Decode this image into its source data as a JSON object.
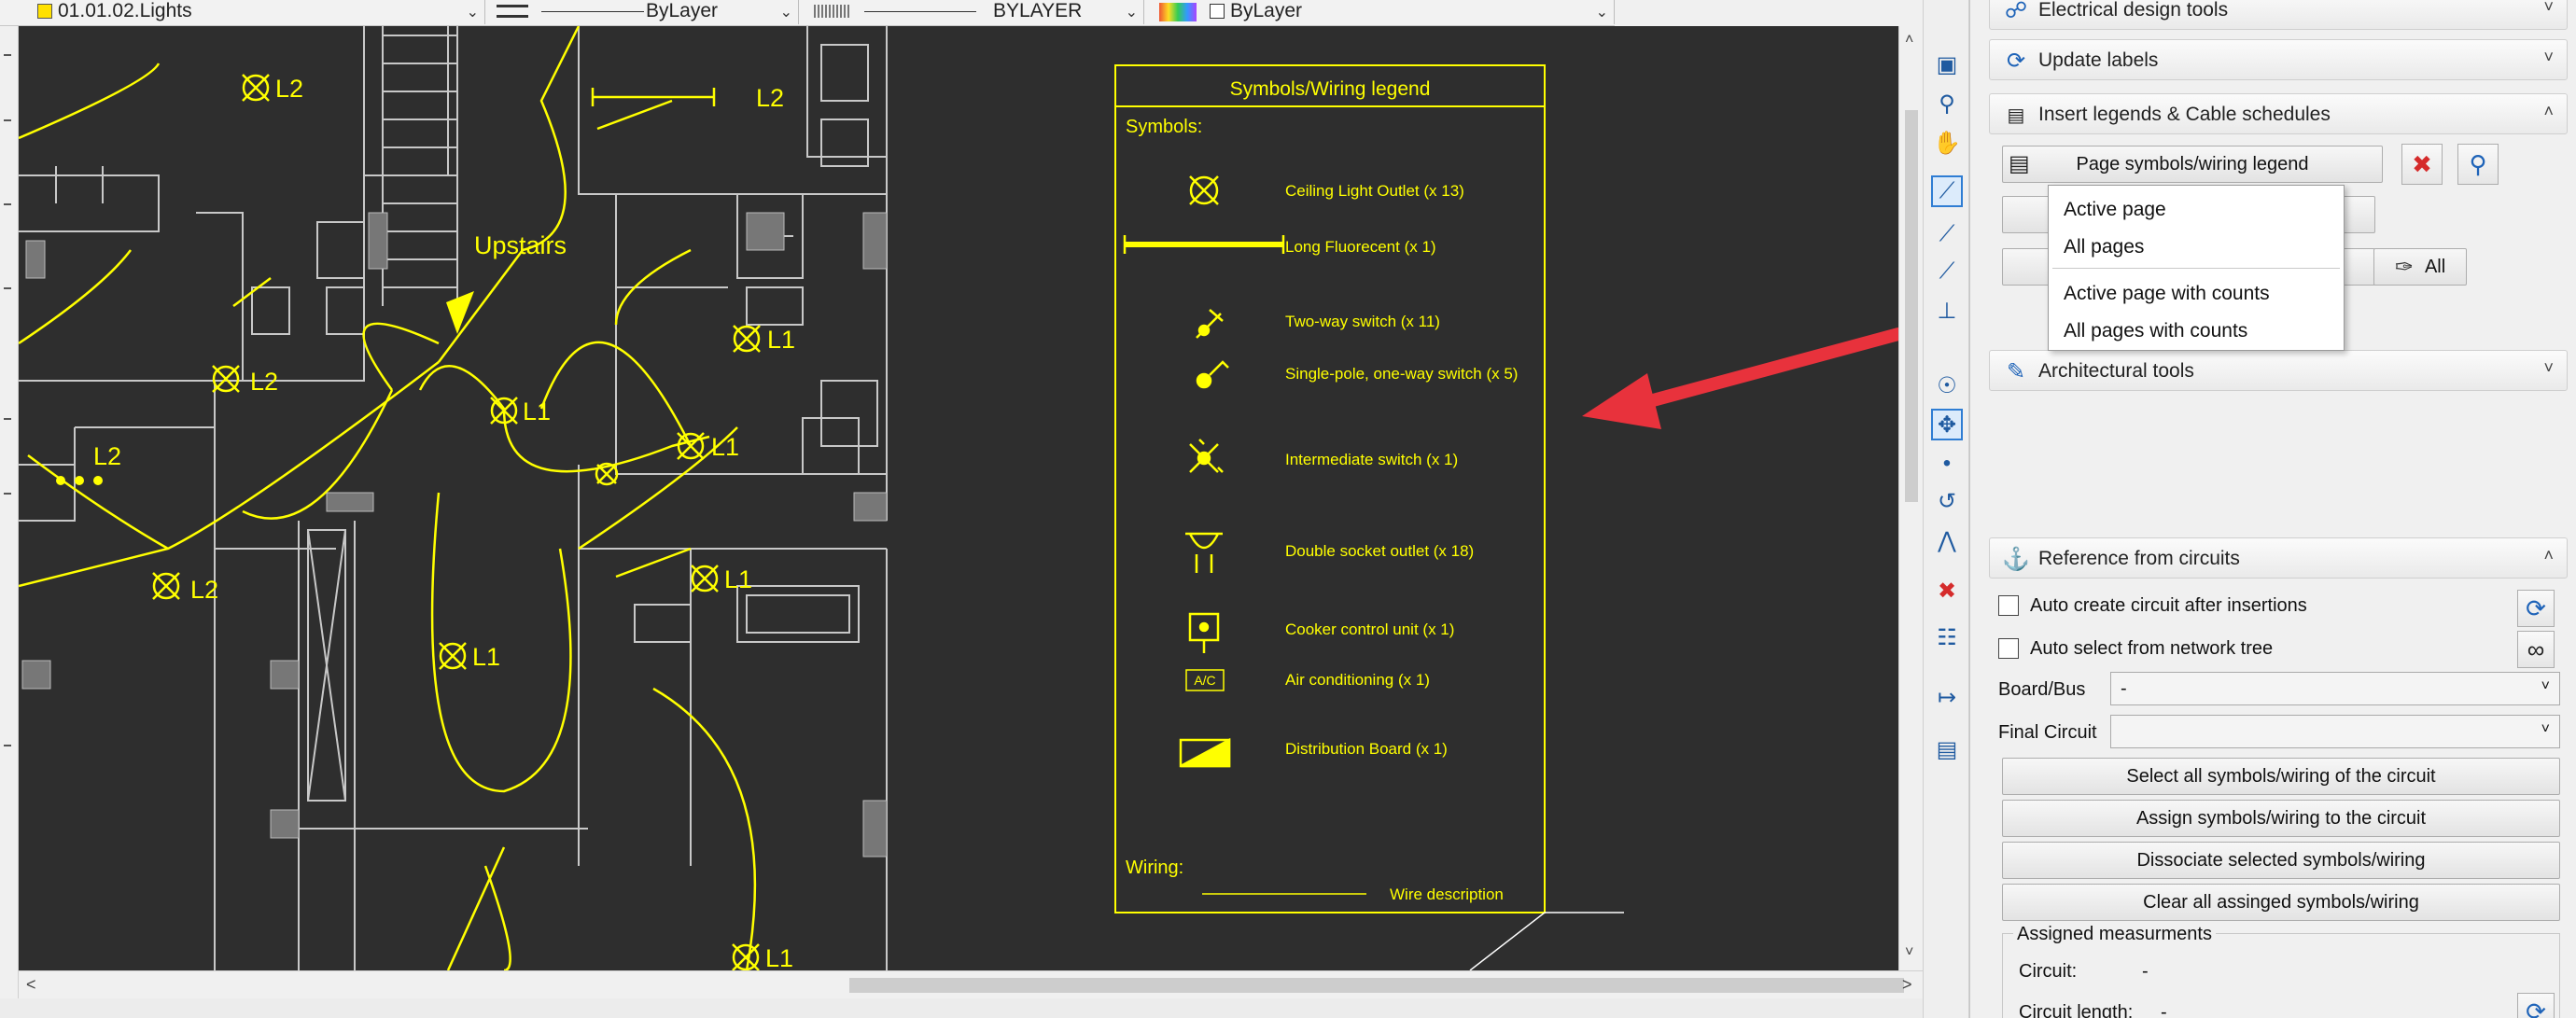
{
  "toolbar": {
    "layer": "01.01.02.Lights",
    "linetype": "ByLayer",
    "lineweight": "BYLAYER",
    "color": "ByLayer"
  },
  "legend": {
    "title": "Symbols/Wiring legend",
    "symbols_header": "Symbols:",
    "items": [
      "Ceiling Light Outlet (x 13)",
      "Long Fluorecent (x 1)",
      "Two-way switch (x 11)",
      "Single-pole, one-way switch (x 5)",
      "Intermediate switch (x 1)",
      "Double socket outlet (x 18)",
      "Cooker control unit (x 1)",
      "Air conditioning (x 1)",
      "Distribution Board (x 1)"
    ],
    "ac_symbol": "A/C",
    "wiring_header": "Wiring:",
    "wire_description": "Wire description"
  },
  "plan_labels": {
    "upstairs": "Upstairs",
    "tags": [
      "L2",
      "L2",
      "L2",
      "L2",
      "L2",
      "L1",
      "L1",
      "L1",
      "L1",
      "L1",
      "L1"
    ]
  },
  "panel": {
    "sections": {
      "electrical": "Electrical design tools",
      "update": "Update labels",
      "insert": "Insert legends & Cable schedules",
      "architectural": "Architectural tools",
      "reference": "Reference from circuits"
    },
    "page_legend_button": "Page symbols/wiring legend",
    "all_button": "All",
    "menu": [
      "Active page",
      "All pages",
      "Active page with counts",
      "All pages with counts"
    ],
    "auto_create": "Auto create circuit after insertions",
    "auto_select": "Auto select from network tree",
    "board_label": "Board/Bus",
    "board_value": "-",
    "final_circuit_label": "Final Circuit",
    "final_circuit_value": "",
    "buttons": [
      "Select all symbols/wiring of the circuit",
      "Assign symbols/wiring to the circuit",
      "Dissociate selected symbols/wiring",
      "Clear all assinged symbols/wiring"
    ],
    "measurements_header": "Assigned measurments",
    "circuit_label": "Circuit:",
    "circuit_value": "-",
    "length_label": "Circuit length:",
    "length_value": "-"
  },
  "colors": {
    "canvas": "#2e2e2e",
    "yellow": "#ffff00",
    "wall": "#c8c8c8",
    "arrow": "#e8323c",
    "accent": "#1e63b8"
  }
}
